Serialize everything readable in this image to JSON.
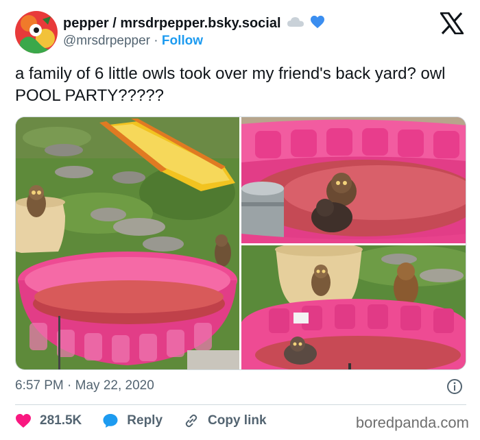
{
  "header": {
    "display_name": "pepper / mrsdrpepper.bsky.social",
    "handle": "@mrsdrpepper",
    "separator": "·",
    "follow_label": "Follow"
  },
  "tweet": {
    "text": "a family of 6 little owls took over my friend's back yard? owl POOL PARTY?????"
  },
  "meta": {
    "timestamp": "6:57 PM · May 22, 2020"
  },
  "actions": {
    "likes_count": "281.5K",
    "reply_label": "Reply",
    "copy_link_label": "Copy link"
  },
  "watermark": "boredpanda.com",
  "colors": {
    "accent": "#1d9bf0",
    "like": "#f91880",
    "text_primary": "#0f1419",
    "text_secondary": "#536471",
    "pool_pink": "#e8428c"
  },
  "icons": [
    "avatar-image",
    "cloud-icon",
    "heart-icon",
    "x-logo-icon",
    "info-icon",
    "like-heart-icon",
    "reply-bubble-icon",
    "link-icon"
  ]
}
